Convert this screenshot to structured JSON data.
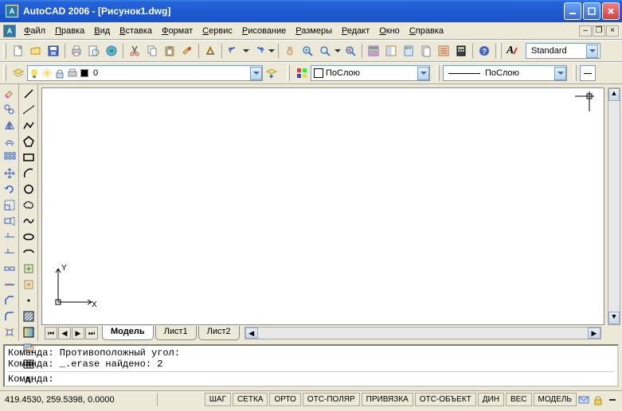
{
  "title": "AutoCAD 2006 - [Рисунок1.dwg]",
  "menu": [
    "Файл",
    "Правка",
    "Вид",
    "Вставка",
    "Формат",
    "Сервис",
    "Рисование",
    "Размеры",
    "Редакт",
    "Окно",
    "Справка"
  ],
  "text_style": "Standard",
  "layer": {
    "name": "0"
  },
  "color_combo": "ПоСлою",
  "linetype_combo": "ПоСлою",
  "tabs": {
    "active": "Модель",
    "others": [
      "Лист1",
      "Лист2"
    ]
  },
  "ucs": {
    "x": "X",
    "y": "Y"
  },
  "command_lines": [
    "Команда: Противоположный угол:",
    "Команда: _.erase найдено: 2"
  ],
  "command_prompt": "Команда:",
  "status": {
    "coords": "419.4530, 259.5398, 0.0000",
    "toggles": [
      "ШАГ",
      "СЕТКА",
      "ОРТО",
      "ОТС-ПОЛЯР",
      "ПРИВЯЗКА",
      "ОТС-ОБЪЕКТ",
      "ДИН",
      "ВЕС",
      "МОДЕЛЬ"
    ]
  }
}
